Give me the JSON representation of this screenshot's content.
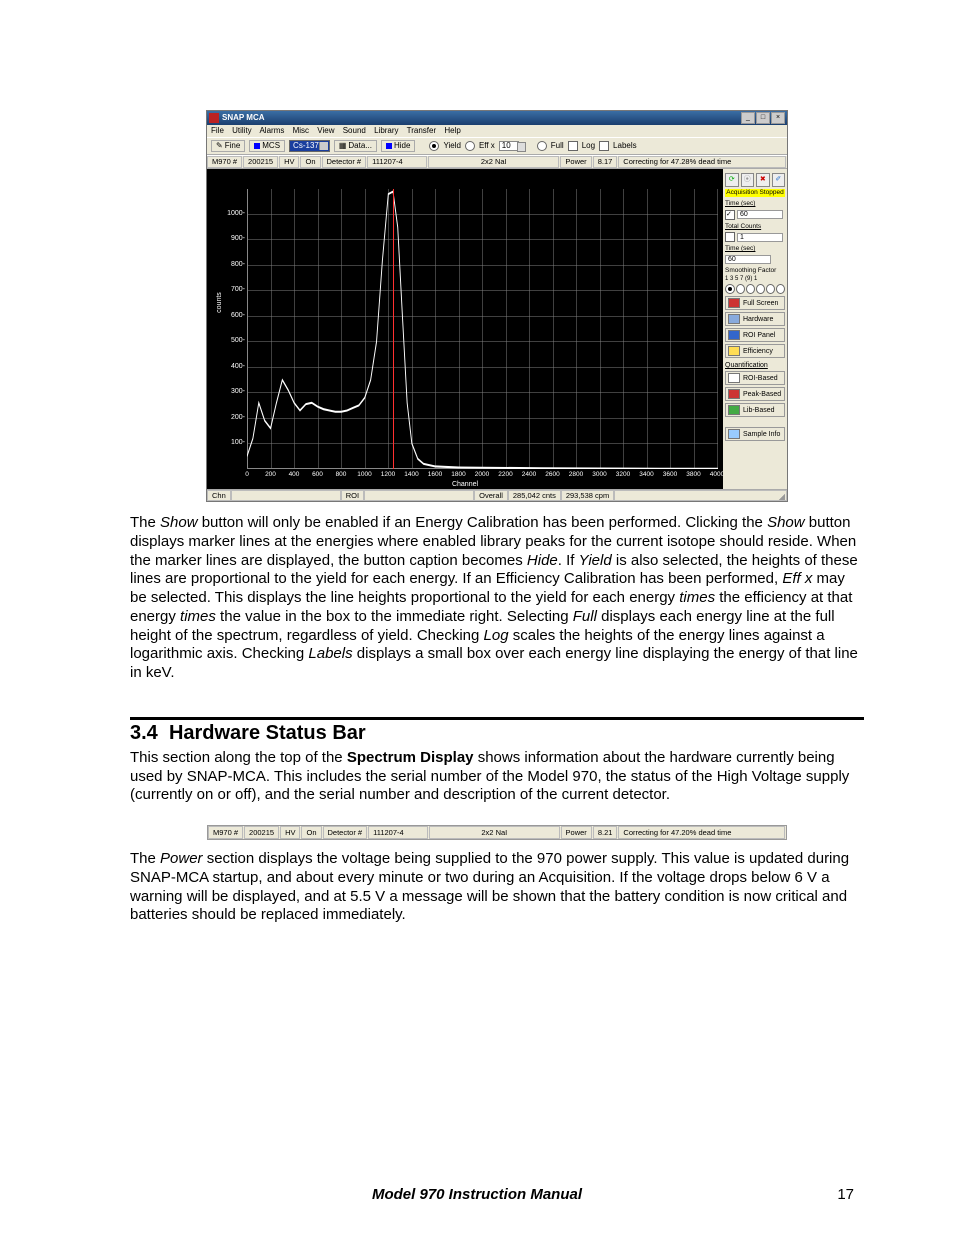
{
  "app": {
    "title": "SNAP MCA",
    "menus": [
      "File",
      "Utility",
      "Alarms",
      "Misc",
      "View",
      "Sound",
      "Library",
      "Transfer",
      "Help"
    ],
    "toolbar": {
      "fine": "Fine",
      "mcs": "MCS",
      "isotope": "Cs-137",
      "data": "Data...",
      "hide": "Hide",
      "opt_yield": "Yield",
      "opt_effx": "Eff x",
      "effx_val": "10",
      "opt_full": "Full",
      "opt_log": "Log",
      "opt_labels": "Labels"
    },
    "hw": {
      "m970_lbl": "M970 #",
      "m970_val": "200215",
      "hv_lbl": "HV",
      "hv_val": "On",
      "det_lbl": "Detector #",
      "det_val": "111207-4",
      "det_desc": "2x2 NaI",
      "power_lbl": "Power",
      "power_val": "8.17",
      "correction": "Correcting for 47.28% dead time"
    },
    "side": {
      "acq": "Acquisition Stopped",
      "time_sec_lbl": "Time (sec)",
      "time_sec_val": "60",
      "total_counts_lbl": "Total Counts",
      "total_counts_val": "1",
      "time_box_lbl": "Time (sec)",
      "time_box_val": "60",
      "smooth_lbl": "Smoothing Factor",
      "smooth_nums": "1 3 5 7 (9) 1",
      "full_screen": "Full Screen",
      "hardware": "Hardware",
      "roi_panel": "ROI Panel",
      "efficiency": "Efficiency",
      "quant": "Quantification",
      "roi_based": "ROI-Based",
      "peak_based": "Peak-Based",
      "lib_based": "Lib-Based",
      "sample_info": "Sample Info"
    },
    "bottom": {
      "chn_lbl": "Chn",
      "chn_val": "",
      "roi_lbl": "ROI",
      "overall_lbl": "Overall",
      "overall_cnts": "285,042 cnts",
      "overall_cpm": "293,538 cpm"
    }
  },
  "chart_data": {
    "type": "line",
    "xlabel": "Channel",
    "ylabel": "counts",
    "xlim": [
      0,
      4000
    ],
    "ylim": [
      0,
      1100
    ],
    "x_ticks": [
      0,
      200,
      400,
      600,
      800,
      1000,
      1200,
      1400,
      1600,
      1800,
      2000,
      2200,
      2400,
      2600,
      2800,
      3000,
      3200,
      3400,
      3600,
      3800,
      4000
    ],
    "y_ticks": [
      100,
      200,
      300,
      400,
      500,
      600,
      700,
      800,
      900,
      1000
    ],
    "marker_channel": 1240,
    "series": [
      {
        "name": "spectrum",
        "points": [
          [
            0,
            50
          ],
          [
            50,
            120
          ],
          [
            100,
            260
          ],
          [
            150,
            190
          ],
          [
            200,
            160
          ],
          [
            250,
            260
          ],
          [
            300,
            350
          ],
          [
            350,
            310
          ],
          [
            400,
            260
          ],
          [
            450,
            230
          ],
          [
            500,
            255
          ],
          [
            550,
            260
          ],
          [
            600,
            245
          ],
          [
            650,
            235
          ],
          [
            700,
            230
          ],
          [
            750,
            225
          ],
          [
            800,
            225
          ],
          [
            850,
            230
          ],
          [
            900,
            240
          ],
          [
            950,
            250
          ],
          [
            1000,
            280
          ],
          [
            1050,
            350
          ],
          [
            1100,
            500
          ],
          [
            1150,
            820
          ],
          [
            1200,
            1080
          ],
          [
            1240,
            1090
          ],
          [
            1280,
            950
          ],
          [
            1320,
            600
          ],
          [
            1360,
            260
          ],
          [
            1400,
            100
          ],
          [
            1450,
            40
          ],
          [
            1500,
            20
          ],
          [
            1600,
            10
          ],
          [
            1800,
            6
          ],
          [
            2000,
            5
          ],
          [
            2500,
            3
          ],
          [
            3000,
            2
          ],
          [
            3500,
            1
          ],
          [
            4000,
            1
          ]
        ]
      }
    ]
  },
  "doc": {
    "para1_a": "The ",
    "para1_show": "Show",
    "para1_b": " button will only be enabled if an Energy Calibration has been performed. Clicking the ",
    "para1_show2": "Show",
    "para1_c": " button displays marker lines at the energies where enabled library peaks for the current isotope should reside. When the marker lines are displayed, the button caption becomes ",
    "para1_hide": "Hide",
    "para1_d": ". If ",
    "para1_yield": "Yield",
    "para1_e": " is also selected, the heights of these lines are proportional to the yield for each energy. If an Efficiency Calibration has been performed, ",
    "para1_effx": "Eff x",
    "para1_f": " may be selected.  This displays the line heights proportional to the yield for each energy ",
    "para1_times1": "times",
    "para1_g": " the efficiency at that energy ",
    "para1_times2": "times",
    "para1_h": " the value in the box to the immediate right. Selecting ",
    "para1_full": "Full",
    "para1_i": " displays each energy line at the full height of the spectrum, regardless of yield. Checking ",
    "para1_log": "Log",
    "para1_j": " scales the heights of the energy lines against a logarithmic axis. Checking ",
    "para1_labels": "Labels",
    "para1_k": " displays a small box over each energy line displaying the energy of that line in keV.",
    "sec_num": "3.4",
    "sec_title": "Hardware Status Bar",
    "para2_a": "This section along the top of the ",
    "para2_sd": "Spectrum Display",
    "para2_b": " shows information about the hardware currently being used by SNAP-MCA. This includes the serial number of the Model 970, the status of the High Voltage supply (currently on or off), and the serial number and description of the current detector.",
    "hw2": {
      "m970_lbl": "M970 #",
      "m970_val": "200215",
      "hv_lbl": "HV",
      "hv_val": "On",
      "det_lbl": "Detector #",
      "det_val": "111207-4",
      "det_desc": "2x2 NaI",
      "power_lbl": "Power",
      "power_val": "8.21",
      "correction": "Correcting for 47.20% dead time"
    },
    "para3_a": "The ",
    "para3_power": "Power",
    "para3_b": " section displays the voltage being supplied to the 970 power supply. This value is updated during SNAP-MCA startup, and about every minute or two during an Acquisition. If the voltage drops below 6 V a warning will be displayed, and at 5.5 V a message will be shown that the battery condition is now critical and batteries should be replaced immediately.",
    "footer_title": "Model 970 Instruction Manual",
    "footer_page": "17"
  }
}
